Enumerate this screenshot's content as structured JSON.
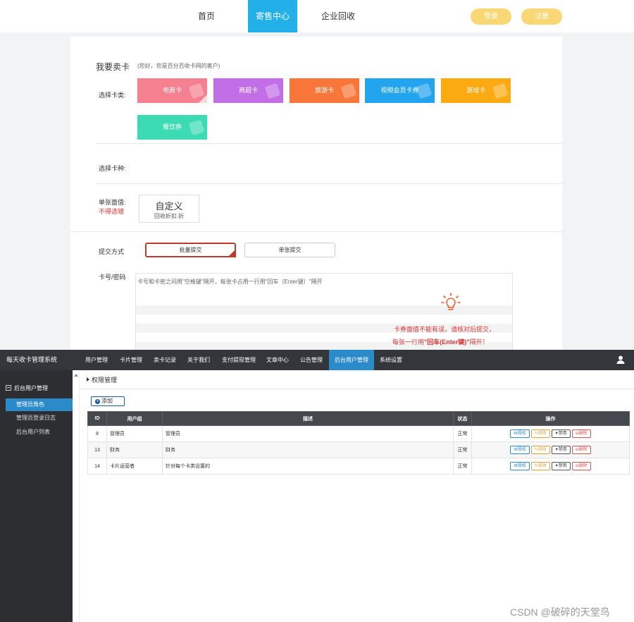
{
  "site": {
    "nav": {
      "home": "首页",
      "sell_center": "寄售中心",
      "enterprise": "企业回收"
    },
    "login": "登录",
    "register": "注册"
  },
  "sell": {
    "title": "我要卖卡",
    "subtitle": "(您好，您是百分百收卡网的客户)",
    "card_type_label": "选择卡类:",
    "card_types": [
      {
        "label": "电商卡",
        "color": "#f5808f"
      },
      {
        "label": "商超卡",
        "color": "#c26ee6"
      },
      {
        "label": "旅游卡",
        "color": "#f9763a"
      },
      {
        "label": "视频会员卡券",
        "color": "#22a4ee"
      },
      {
        "label": "游戏卡",
        "color": "#fbaa12"
      },
      {
        "label": "餐饮券",
        "color": "#3ddbb4"
      }
    ],
    "card_kind_label": "选择卡种:",
    "face_value_label": "单张面值:",
    "face_value_warning": "不得选错",
    "custom": {
      "title": "自定义",
      "sub": "回收折扣.折"
    },
    "submit_method_label": "提交方式",
    "batch_submit": "批量提交",
    "single_submit": "单张提交",
    "card_password_label": "卡号/密码",
    "textarea_placeholder": "卡号和卡密之间用\"空格键\"隔开，每张卡占用一行用\"回车（Enter键）\"隔开",
    "tip_line1": "卡券面值不能有误，请核对后提交，",
    "tip_line2_prefix": "每张一行用",
    "tip_line2_emph": "\"回车(Enter键)\"",
    "tip_line2_suffix": "隔开！"
  },
  "admin": {
    "brand": "每天收卡管理系统",
    "nav": [
      "用户管理",
      "卡片管理",
      "卖卡记录",
      "关于我们",
      "支付提现管理",
      "文章中心",
      "公告管理",
      "后台用户管理",
      "系统设置"
    ],
    "sidebar": {
      "group": "后台用户管理",
      "items": [
        "管理员角色",
        "管理员登录日志",
        "后台用户列表"
      ]
    },
    "section_title": "权限管理",
    "add_button": "添加",
    "table": {
      "headers": [
        "ID",
        "用户组",
        "描述",
        "状态",
        "操作"
      ],
      "rows": [
        {
          "id": "8",
          "group": "管理员",
          "desc": "管理员",
          "status": "正常"
        },
        {
          "id": "13",
          "group": "财务",
          "desc": "财务",
          "status": "正常"
        },
        {
          "id": "14",
          "group": "卡片运营者",
          "desc": "针对每个卡类设置的",
          "status": "正常"
        }
      ],
      "actions": {
        "auth": "授权",
        "edit": "修改",
        "ban": "禁用",
        "delete": "删除"
      }
    }
  },
  "watermark": "CSDN @破碎的天堂鸟"
}
